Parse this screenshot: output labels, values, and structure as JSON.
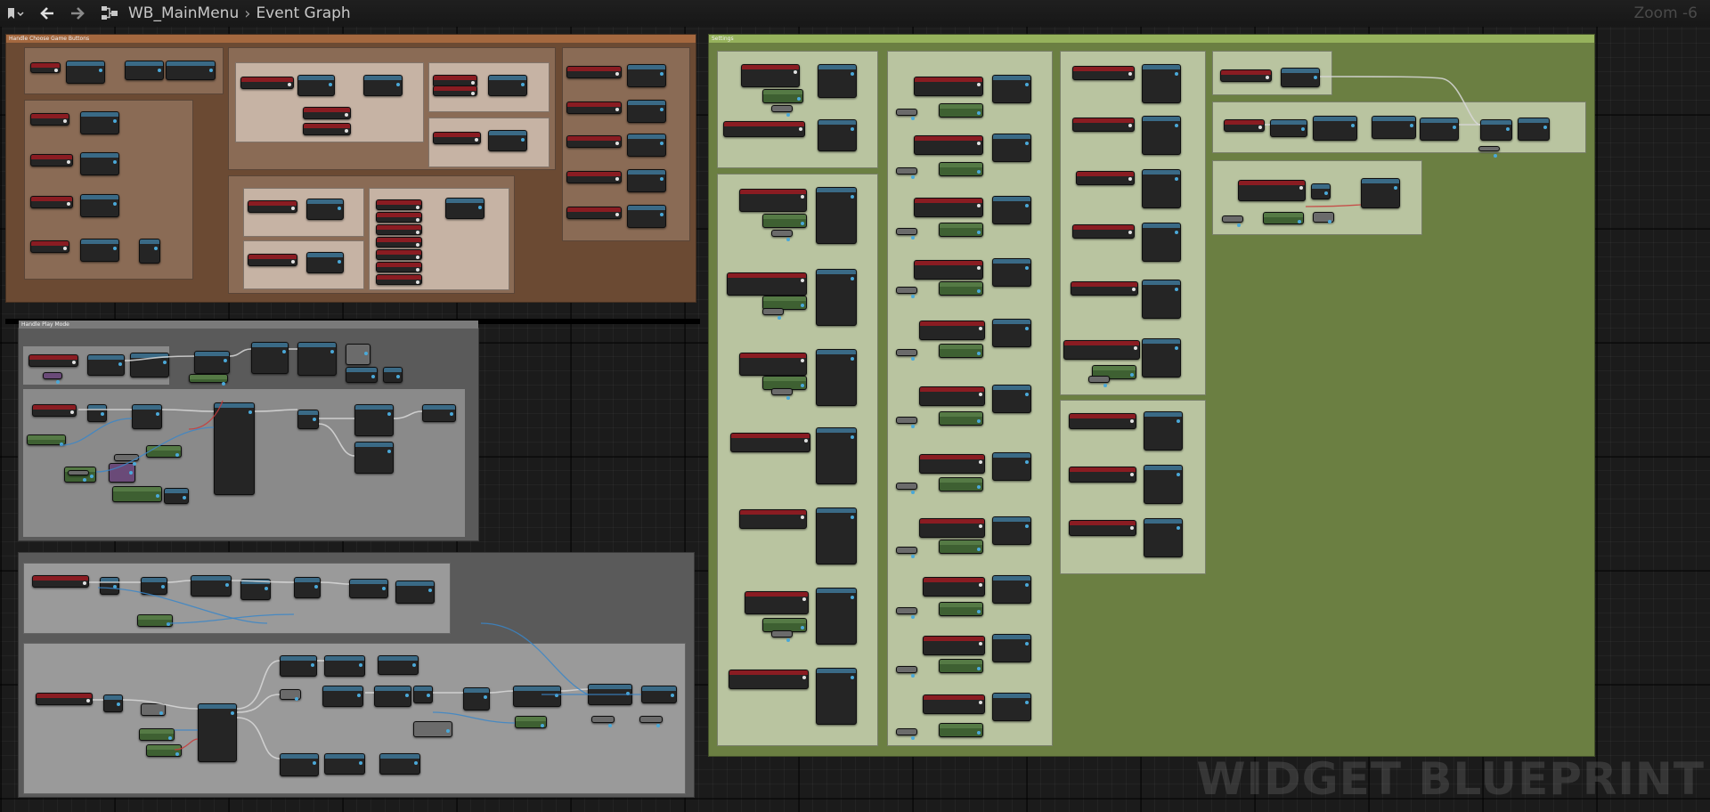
{
  "toolbar": {
    "breadcrumb": [
      "WB_MainMenu",
      "Event Graph"
    ],
    "zoom": "Zoom -6"
  },
  "icons": {
    "bookmark": "bookmark-icon",
    "back": "arrow-left-icon",
    "forward": "arrow-right-icon",
    "graph": "graph-icon",
    "separator": "chevron-right-icon"
  },
  "colors": {
    "comment_orange_title": "#a4683f",
    "comment_orange_body": "#6b4a33",
    "comment_green_title": "#96b25c",
    "comment_green_body": "#6b7f42",
    "comment_grey_body": "#5a5a5a",
    "node_header_red": "#8a1c22",
    "node_header_blue": "#3a6a86",
    "node_green": "#3e6032",
    "exec_wire": "#d8d8d8",
    "data_wire_blue": "#3a86c8",
    "data_wire_red": "#c83a3a"
  },
  "comments": {
    "menu_buttons": "Handle Choose Game Buttons",
    "play_mode": "Handle Play Mode",
    "settings": "Settings"
  },
  "watermark": "WIDGET BLUEPRINT"
}
